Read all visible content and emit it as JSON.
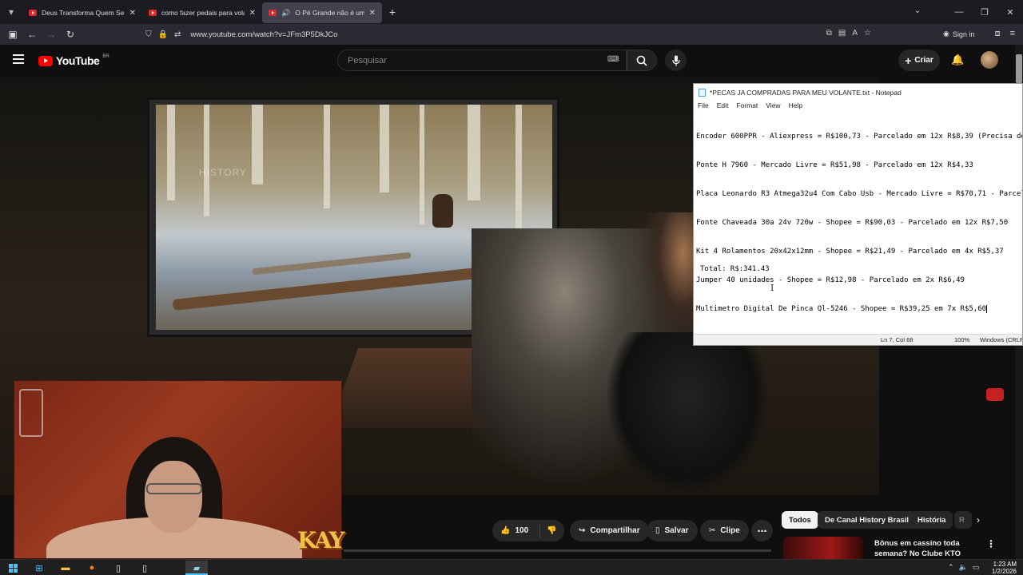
{
  "browser": {
    "tabs": [
      {
        "title": "Deus Transforma Quem Se Arre",
        "active": false,
        "audio": false
      },
      {
        "title": "como fazer pedais para volante",
        "active": false,
        "audio": false
      },
      {
        "title": "O Pé Grande não é um prim",
        "active": true,
        "audio": true
      }
    ],
    "url": "www.youtube.com/watch?v=JFm3P5DkJCo",
    "sign_in": "Sign in"
  },
  "youtube": {
    "logo_text": "YouTube",
    "country_code": "BR",
    "search_placeholder": "Pesquisar",
    "create_label": "Criar",
    "video_watermark": "HISTORY",
    "actions": {
      "like_count": "100",
      "share_label": "Compartilhar",
      "save_label": "Salvar",
      "clip_label": "Clipe"
    },
    "chips": [
      {
        "label": "Todos",
        "active": true
      },
      {
        "label": "De Canal History Brasil",
        "active": false
      },
      {
        "label": "História",
        "active": false
      },
      {
        "label": "R",
        "active": false
      }
    ],
    "recommendation": {
      "title": "Bônus em cassino toda semana? No Clube KTO você e"
    }
  },
  "notepad": {
    "title": "*PECAS JA COMPRADAS PARA MEU VOLANTE.txt - Notepad",
    "menu": [
      "File",
      "Edit",
      "Format",
      "View",
      "Help"
    ],
    "lines": [
      "Encoder 600PPR - Aliexpress = R$100,73 - Parcelado em 12x R$8,39 (Precisa de",
      "Ponte H 7960 - Mercado Livre = R$51,98 - Parcelado em 12x R$4,33",
      "Placa Leonardo R3 Atmega32u4 Com Cabo Usb - Mercado Livre = R$70,71 - Parcela",
      "Fonte Chaveada 30a 24v 720w - Shopee = R$90,03 - Parcelado em 12x R$7,50",
      "Kit 4 Rolamentos 20x42x12mm - Shopee = R$21,49 - Parcelado em 4x R$5,37",
      "Jumper 40 unidades - Shopee = R$12,98 - Parcelado em 2x R$6,49",
      "Multimetro Digital De Pinca Ql-5246 - Shopee = R$39,25 em 7x R$5,60"
    ],
    "total": "Total: R$:341.43",
    "status": {
      "position": "Ln 7, Col 68",
      "zoom": "100%",
      "line_ending": "Windows (CRLF)"
    }
  },
  "taskbar": {
    "time": "1:23 AM",
    "date": "1/2/2026"
  },
  "stream_overlay": {
    "sticker_text": "KAY"
  }
}
